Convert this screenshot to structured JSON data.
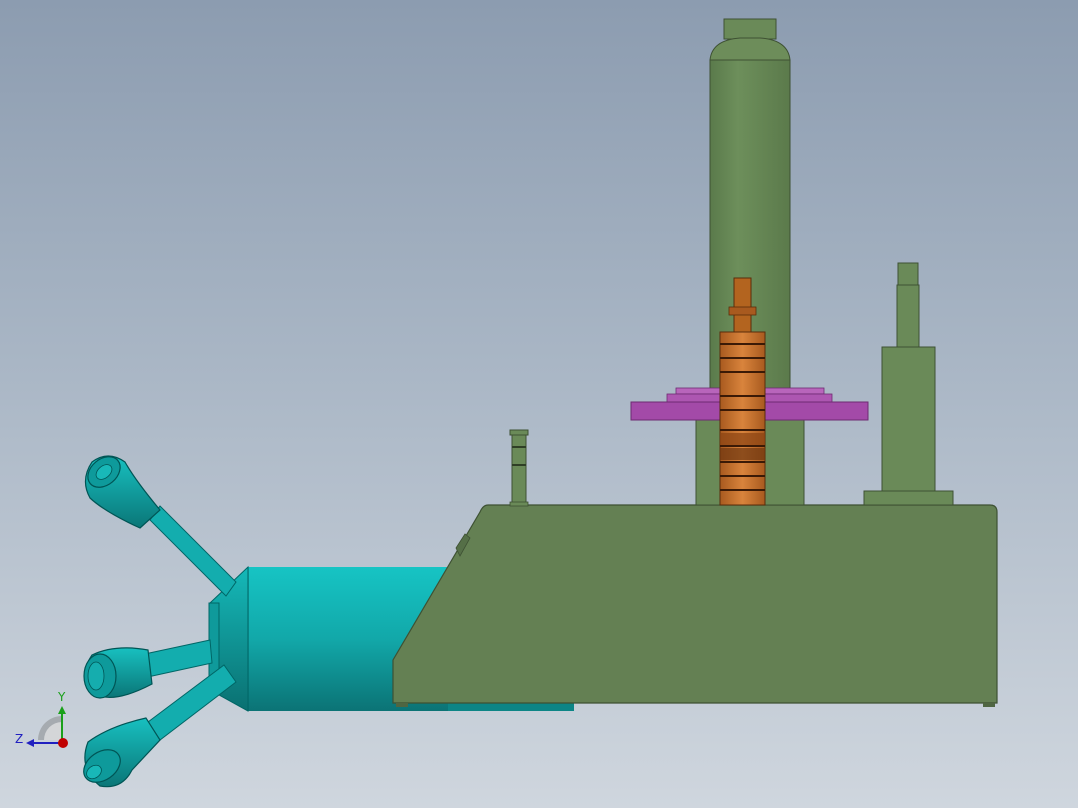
{
  "viewport": {
    "background_top": "#8c9cb0",
    "background_bottom": "#cfd6de"
  },
  "model": {
    "colors": {
      "housing_green": "#648053",
      "housing_green_light": "#6f8c5c",
      "housing_green_dark": "#4f6642",
      "cylinder_green": "#6a8a58",
      "teal": "#17b7b7",
      "teal_dark": "#0a7f80",
      "gear_orange": "#c8742e",
      "gear_dark": "#7a3d12",
      "plate_purple": "#a34aa8",
      "plate_purple_light": "#b865bb"
    }
  },
  "triad": {
    "y_label": "Y",
    "z_label": "Z",
    "y_color": "#1aa01a",
    "z_color": "#2020c0",
    "x_color": "#c00000"
  }
}
